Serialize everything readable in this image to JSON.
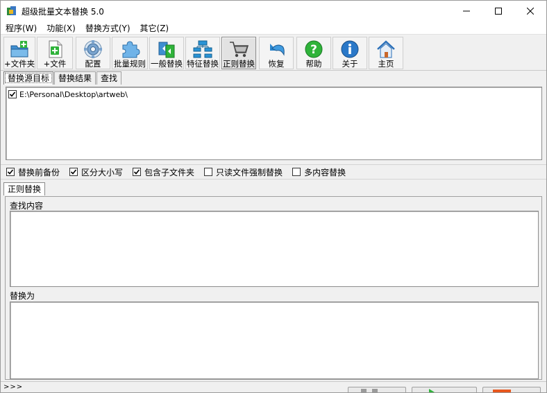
{
  "window": {
    "title": "超级批量文本替换 5.0"
  },
  "menu": [
    "程序(W)",
    "功能(X)",
    "替换方式(Y)",
    "其它(Z)"
  ],
  "toolbar": {
    "add_folder": "+文件夹",
    "add_file": "+文件",
    "config": "配置",
    "batch_rules": "批量规则",
    "general_replace": "一般替换",
    "feature_replace": "特征替换",
    "regex_replace": "正则替换",
    "restore": "恢复",
    "help": "帮助",
    "about": "关于",
    "home": "主页"
  },
  "tabs": [
    "替换源目标",
    "替换结果",
    "查找"
  ],
  "targets": [
    {
      "path": "E:\\Personal\\Desktop\\artweb\\",
      "checked": true
    }
  ],
  "options": {
    "backup": {
      "label": "替换前备份",
      "checked": true
    },
    "case_sensitive": {
      "label": "区分大小写",
      "checked": true
    },
    "subfolders": {
      "label": "包含子文件夹",
      "checked": true
    },
    "readonly_force": {
      "label": "只读文件强制替换",
      "checked": false
    },
    "multi_content": {
      "label": "多内容替换",
      "checked": false
    }
  },
  "lower_tab": "正则替换",
  "find_label": "查找内容",
  "replace_label": "替换为",
  "status": ">>>",
  "colors": {
    "play_green": "#2fb33a",
    "stop_orange": "#e8561c"
  }
}
